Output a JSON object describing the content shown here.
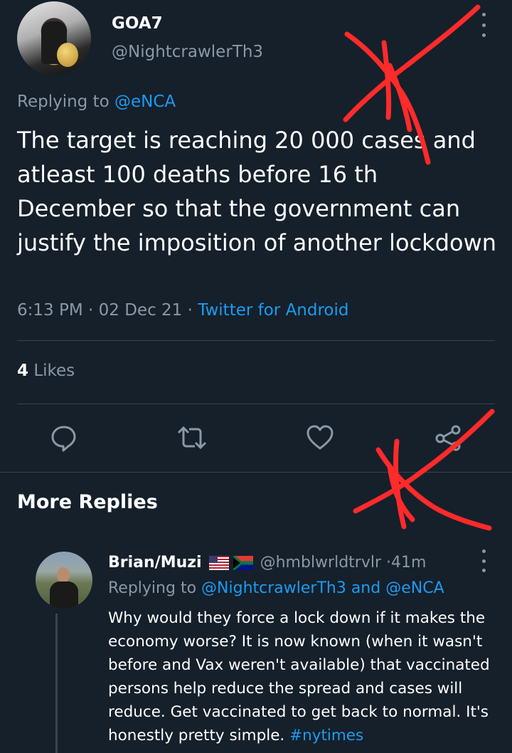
{
  "tweet": {
    "display_name": "GOA7",
    "handle": "@NightcrawlerTh3",
    "replying_prefix": "Replying to",
    "replying_to": "@eNCA",
    "text": "The target is reaching 20 000 cases and atleast 100 deaths before 16 th December so that the government can justify the imposition of another lockdown",
    "time": "6:13 PM",
    "date": "02 Dec 21",
    "source": "Twitter for Android",
    "likes_count": "4",
    "likes_label": "Likes",
    "separator": "·"
  },
  "actions": {
    "reply_icon": "reply-icon",
    "retweet_icon": "retweet-icon",
    "like_icon": "heart-icon",
    "share_icon": "share-icon"
  },
  "more_replies": {
    "title": "More Replies"
  },
  "reply": {
    "display_name": "Brian/Muzi",
    "flags": [
      "us-flag-icon",
      "south-africa-flag-icon"
    ],
    "handle": "@hmblwrldtrvlr",
    "separator": "·",
    "time": "41m",
    "replying_prefix": "Replying to",
    "replying_to_1": "@NightcrawlerTh3",
    "replying_and": "and",
    "replying_to_2": "@eNCA",
    "text": "Why would they force a lock down if it makes the economy worse?  It is now known (when it wasn't before and Vax weren't available) that vaccinated persons help reduce the spread and cases will reduce. Get vaccinated to get back to normal. It's honestly pretty simple. ",
    "hashtag": "#nytimes"
  },
  "colors": {
    "background": "#15202b",
    "text": "#ffffff",
    "secondary": "#8b98a5",
    "link": "#1d9bf0",
    "divider": "#38444d",
    "annotation": "#ff2a2a"
  }
}
